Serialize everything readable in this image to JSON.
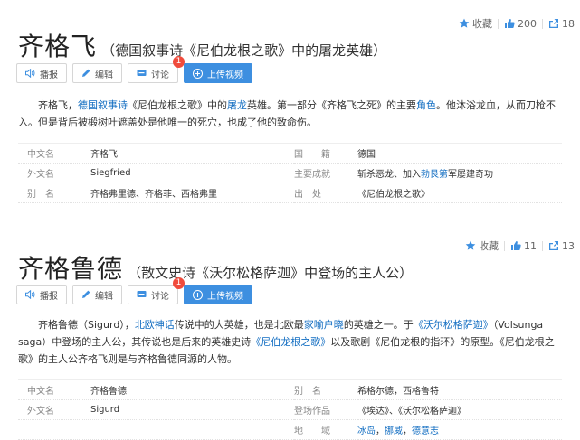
{
  "entries": [
    {
      "favorite_label": "收藏",
      "like_count": "200",
      "share_count": "18",
      "title": "齐格飞",
      "subtitle": "（德国叙事诗《尼伯龙根之歌》中的屠龙英雄）",
      "buttons": {
        "report": "播报",
        "edit": "编辑",
        "discuss": "讨论",
        "discuss_badge": "1",
        "upload": "上传视频"
      },
      "description": {
        "t1": "齐格飞，",
        "l1": "德国叙事诗",
        "t2": "《尼伯龙根之歌》中的",
        "l2": "屠龙",
        "t3": "英雄。第一部分《齐格飞之死》的主要",
        "l3": "角色",
        "t4": "。他沐浴龙血，从而刀枪不入。但是背后被椴树叶遮盖处是他唯一的死穴，也成了他的致命伤。"
      },
      "info": [
        {
          "k": "中文名",
          "v": "齐格飞",
          "k2": "国　　籍",
          "v2": "德国",
          "v2_link": true
        },
        {
          "k": "外文名",
          "v": "Siegfried",
          "k2": "主要成就",
          "v2a": "斩杀恶龙、加入",
          "v2b": "勃艮第",
          "v2c": "军屡建奇功"
        },
        {
          "k": "别　名",
          "v": "齐格弗里德、齐格菲、西格弗里",
          "k2": "出　处",
          "v2": "《尼伯龙根之歌》",
          "v2_link": true
        }
      ]
    },
    {
      "favorite_label": "收藏",
      "like_count": "11",
      "share_count": "13",
      "title": "齐格鲁德",
      "subtitle": "（散文史诗《沃尔松格萨迦》中登场的主人公）",
      "buttons": {
        "report": "播报",
        "edit": "编辑",
        "discuss": "讨论",
        "discuss_badge": "1",
        "upload": "上传视频"
      },
      "description": {
        "t1": "齐格鲁德（Sigurd），",
        "l1": "北欧神话",
        "t2": "传说中的大英雄，也是北欧最",
        "l2": "家喻户晓",
        "t3": "的英雄之一。于",
        "l3": "《沃尔松格萨迦》",
        "t4": "（Volsunga saga）中登场的主人公，其传说也是后来的英雄史诗",
        "l4": "《尼伯龙根之歌》",
        "t5": "以及歌剧《尼伯龙根的指环》的原型。《尼伯龙根之歌》的主人公齐格飞则是与齐格鲁德同源的人物。"
      },
      "info": [
        {
          "k": "中文名",
          "v": "齐格鲁德",
          "k2": "别　名",
          "v2": "希格尔德，西格鲁特"
        },
        {
          "k": "外文名",
          "v": "Sigurd",
          "k2": "登场作品",
          "v2": "《埃达》、《沃尔松格萨迦》"
        },
        {
          "k": "",
          "v": "",
          "k2": "地　　域",
          "v2a": "冰岛",
          "v2b": "，",
          "v2c": "挪威",
          "v2d": "，",
          "v2e": "德意志"
        }
      ]
    }
  ],
  "colors": {
    "link": "#136ec2",
    "primary_button": "#3d8fe0",
    "badge": "#f04b3c",
    "icon_blue": "#3d8fe0"
  }
}
